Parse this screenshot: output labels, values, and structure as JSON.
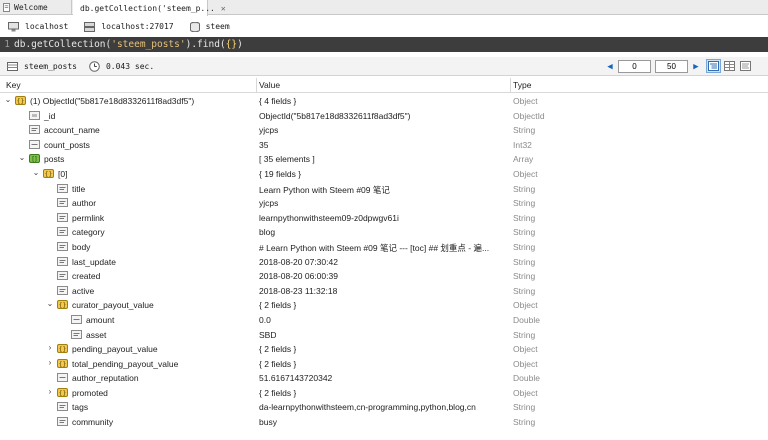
{
  "tabs": [
    {
      "label": "Welcome",
      "active": false
    },
    {
      "label": "db.getCollection('steem_p...",
      "active": true
    }
  ],
  "connection": {
    "host": "localhost",
    "port": "localhost:27017",
    "db": "steem"
  },
  "query": {
    "line_number": "1",
    "prefix": "db.getCollection(",
    "collection": "'steem_posts'",
    "suffix": ").find(",
    "arg": "{}",
    "end": ")"
  },
  "toolbar": {
    "collection": "steem_posts",
    "time": "0.043 sec.",
    "page_from": "0",
    "page_size": "50"
  },
  "columns": {
    "key": "Key",
    "value": "Value",
    "type": "Type"
  },
  "accent": "#1565c0",
  "rows": [
    {
      "key": "(1) ObjectId(\"5b817e18d8332611f8ad3df5\")",
      "value": "{ 4 fields }",
      "type": "Object",
      "depth": 0,
      "twisty": "open",
      "icon": "object-icon"
    },
    {
      "key": "_id",
      "value": "ObjectId(\"5b817e18d8332611f8ad3df5\")",
      "type": "ObjectId",
      "depth": 1,
      "twisty": "none",
      "icon": "id-icon"
    },
    {
      "key": "account_name",
      "value": "yjcps",
      "type": "String",
      "depth": 1,
      "twisty": "none",
      "icon": "string-icon"
    },
    {
      "key": "count_posts",
      "value": "35",
      "type": "Int32",
      "depth": 1,
      "twisty": "none",
      "icon": "number-icon"
    },
    {
      "key": "posts",
      "value": "[ 35 elements ]",
      "type": "Array",
      "depth": 1,
      "twisty": "open",
      "icon": "array-icon"
    },
    {
      "key": "[0]",
      "value": "{ 19 fields }",
      "type": "Object",
      "depth": 2,
      "twisty": "open",
      "icon": "object-icon"
    },
    {
      "key": "title",
      "value": "Learn Python with Steem #09 笔记",
      "type": "String",
      "depth": 3,
      "twisty": "none",
      "icon": "string-icon"
    },
    {
      "key": "author",
      "value": "yjcps",
      "type": "String",
      "depth": 3,
      "twisty": "none",
      "icon": "string-icon"
    },
    {
      "key": "permlink",
      "value": "learnpythonwithsteem09-z0dpwgv61i",
      "type": "String",
      "depth": 3,
      "twisty": "none",
      "icon": "string-icon"
    },
    {
      "key": "category",
      "value": "blog",
      "type": "String",
      "depth": 3,
      "twisty": "none",
      "icon": "string-icon"
    },
    {
      "key": "body",
      "value": "# Learn Python with Steem #09 笔记 --- [toc] ## 划重点 - 遍...",
      "type": "String",
      "depth": 3,
      "twisty": "none",
      "icon": "string-icon"
    },
    {
      "key": "last_update",
      "value": "2018-08-20 07:30:42",
      "type": "String",
      "depth": 3,
      "twisty": "none",
      "icon": "string-icon"
    },
    {
      "key": "created",
      "value": "2018-08-20 06:00:39",
      "type": "String",
      "depth": 3,
      "twisty": "none",
      "icon": "string-icon"
    },
    {
      "key": "active",
      "value": "2018-08-23 11:32:18",
      "type": "String",
      "depth": 3,
      "twisty": "none",
      "icon": "string-icon"
    },
    {
      "key": "curator_payout_value",
      "value": "{ 2 fields }",
      "type": "Object",
      "depth": 3,
      "twisty": "open",
      "icon": "object-icon"
    },
    {
      "key": "amount",
      "value": "0.0",
      "type": "Double",
      "depth": 4,
      "twisty": "none",
      "icon": "number-icon"
    },
    {
      "key": "asset",
      "value": "SBD",
      "type": "String",
      "depth": 4,
      "twisty": "none",
      "icon": "string-icon"
    },
    {
      "key": "pending_payout_value",
      "value": "{ 2 fields }",
      "type": "Object",
      "depth": 3,
      "twisty": "closed",
      "icon": "object-icon"
    },
    {
      "key": "total_pending_payout_value",
      "value": "{ 2 fields }",
      "type": "Object",
      "depth": 3,
      "twisty": "closed",
      "icon": "object-icon"
    },
    {
      "key": "author_reputation",
      "value": "51.6167143720342",
      "type": "Double",
      "depth": 3,
      "twisty": "none",
      "icon": "number-icon"
    },
    {
      "key": "promoted",
      "value": "{ 2 fields }",
      "type": "Object",
      "depth": 3,
      "twisty": "closed",
      "icon": "object-icon"
    },
    {
      "key": "tags",
      "value": "da-learnpythonwithsteem,cn-programming,python,blog,cn",
      "type": "String",
      "depth": 3,
      "twisty": "none",
      "icon": "string-icon"
    },
    {
      "key": "community",
      "value": "busy",
      "type": "String",
      "depth": 3,
      "twisty": "none",
      "icon": "string-icon"
    }
  ]
}
